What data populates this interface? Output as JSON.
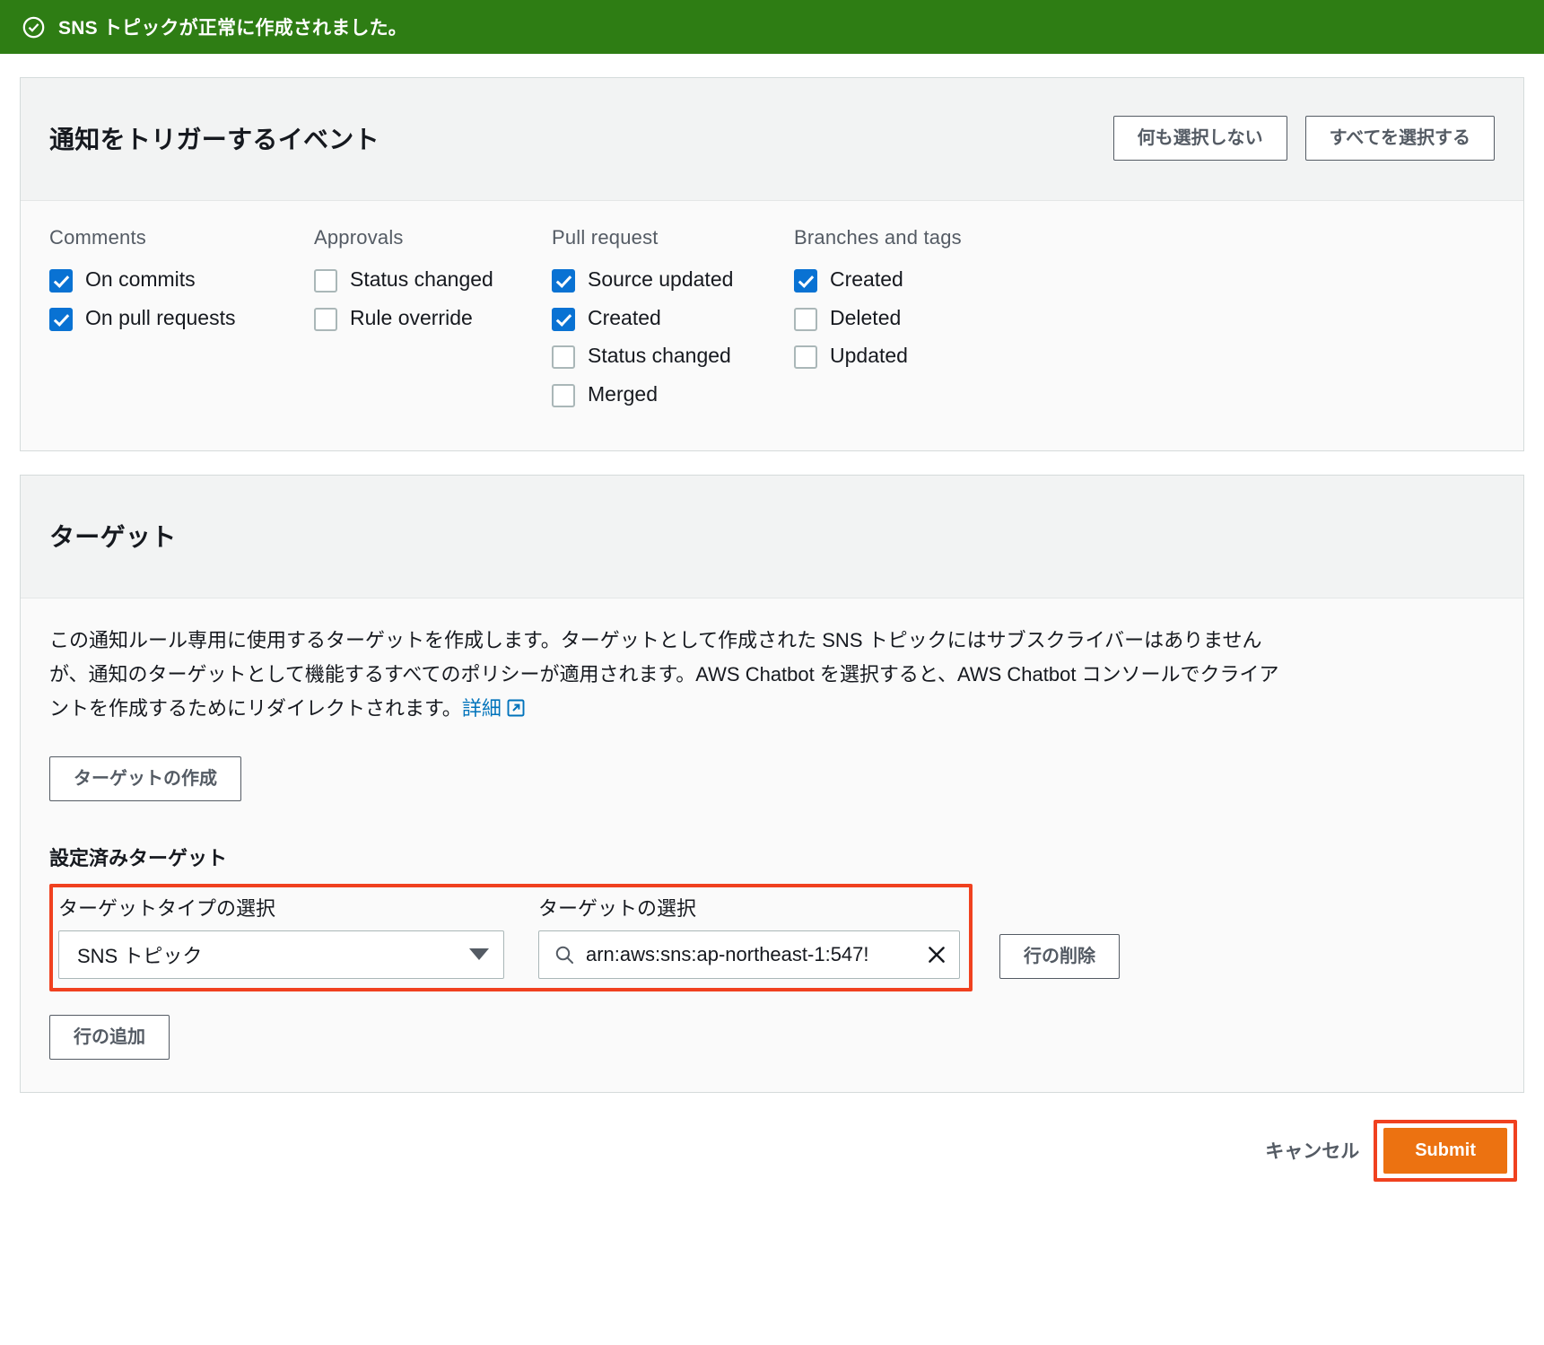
{
  "flash": {
    "icon": "check-circle-icon",
    "message": "SNS トピックが正常に作成されました。",
    "background": "#2e7d14"
  },
  "events_card": {
    "title": "通知をトリガーするイベント",
    "select_none_label": "何も選択しない",
    "select_all_label": "すべてを選択する",
    "columns": [
      {
        "heading": "Comments",
        "items": [
          {
            "label": "On commits",
            "checked": true
          },
          {
            "label": "On pull requests",
            "checked": true
          }
        ]
      },
      {
        "heading": "Approvals",
        "items": [
          {
            "label": "Status changed",
            "checked": false
          },
          {
            "label": "Rule override",
            "checked": false
          }
        ]
      },
      {
        "heading": "Pull request",
        "items": [
          {
            "label": "Source updated",
            "checked": true
          },
          {
            "label": "Created",
            "checked": true
          },
          {
            "label": "Status changed",
            "checked": false
          },
          {
            "label": "Merged",
            "checked": false
          }
        ]
      },
      {
        "heading": "Branches and tags",
        "items": [
          {
            "label": "Created",
            "checked": true
          },
          {
            "label": "Deleted",
            "checked": false
          },
          {
            "label": "Updated",
            "checked": false
          }
        ]
      }
    ]
  },
  "targets_card": {
    "title": "ターゲット",
    "description_part1": "この通知ルール専用に使用するターゲットを作成します。ターゲットとして作成された SNS トピックにはサブスクライバーはありませんが、通知のターゲットとして機能するすべてのポリシーが適用されます。AWS Chatbot を選択すると、AWS Chatbot コンソールでクライアントを作成するためにリダイレクトされます。",
    "description_link": "詳細",
    "description_link_icon": "external-link-icon",
    "create_target_label": "ターゲットの作成",
    "configured_targets_heading": "設定済みターゲット",
    "target_type_label": "ターゲットタイプの選択",
    "target_type_value": "SNS トピック",
    "target_type_caret_icon": "chevron-down-icon",
    "target_select_label": "ターゲットの選択",
    "target_search_icon": "search-icon",
    "target_search_value": "arn:aws:sns:ap-northeast-1:547!",
    "target_clear_icon": "close-icon",
    "delete_row_label": "行の削除",
    "add_row_label": "行の追加",
    "highlight_color": "#f0411f"
  },
  "footer": {
    "cancel_label": "キャンセル",
    "submit_label": "Submit",
    "submit_color": "#ec7211"
  }
}
